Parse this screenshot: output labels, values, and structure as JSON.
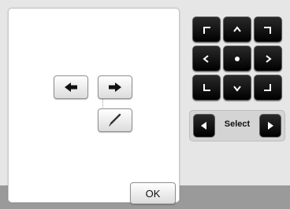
{
  "screen": {
    "ok_label": "OK"
  },
  "icons": {
    "move_left": "arrow-left-icon",
    "move_right": "arrow-right-icon",
    "edit": "pen-icon",
    "dir_up_left": "corner-up-left-icon",
    "dir_up": "chevron-up-icon",
    "dir_up_right": "corner-up-right-icon",
    "dir_left": "chevron-left-icon",
    "dir_center": "dot-icon",
    "dir_right": "chevron-right-icon",
    "dir_down_left": "corner-down-left-icon",
    "dir_down": "chevron-down-icon",
    "dir_down_right": "corner-down-right-icon"
  },
  "select": {
    "label": "Select"
  },
  "colors": {
    "panel_background": "#e6e6e6",
    "footer": "#9a9a9a",
    "dark_button": "#000000",
    "light_button": "#ffffff"
  }
}
